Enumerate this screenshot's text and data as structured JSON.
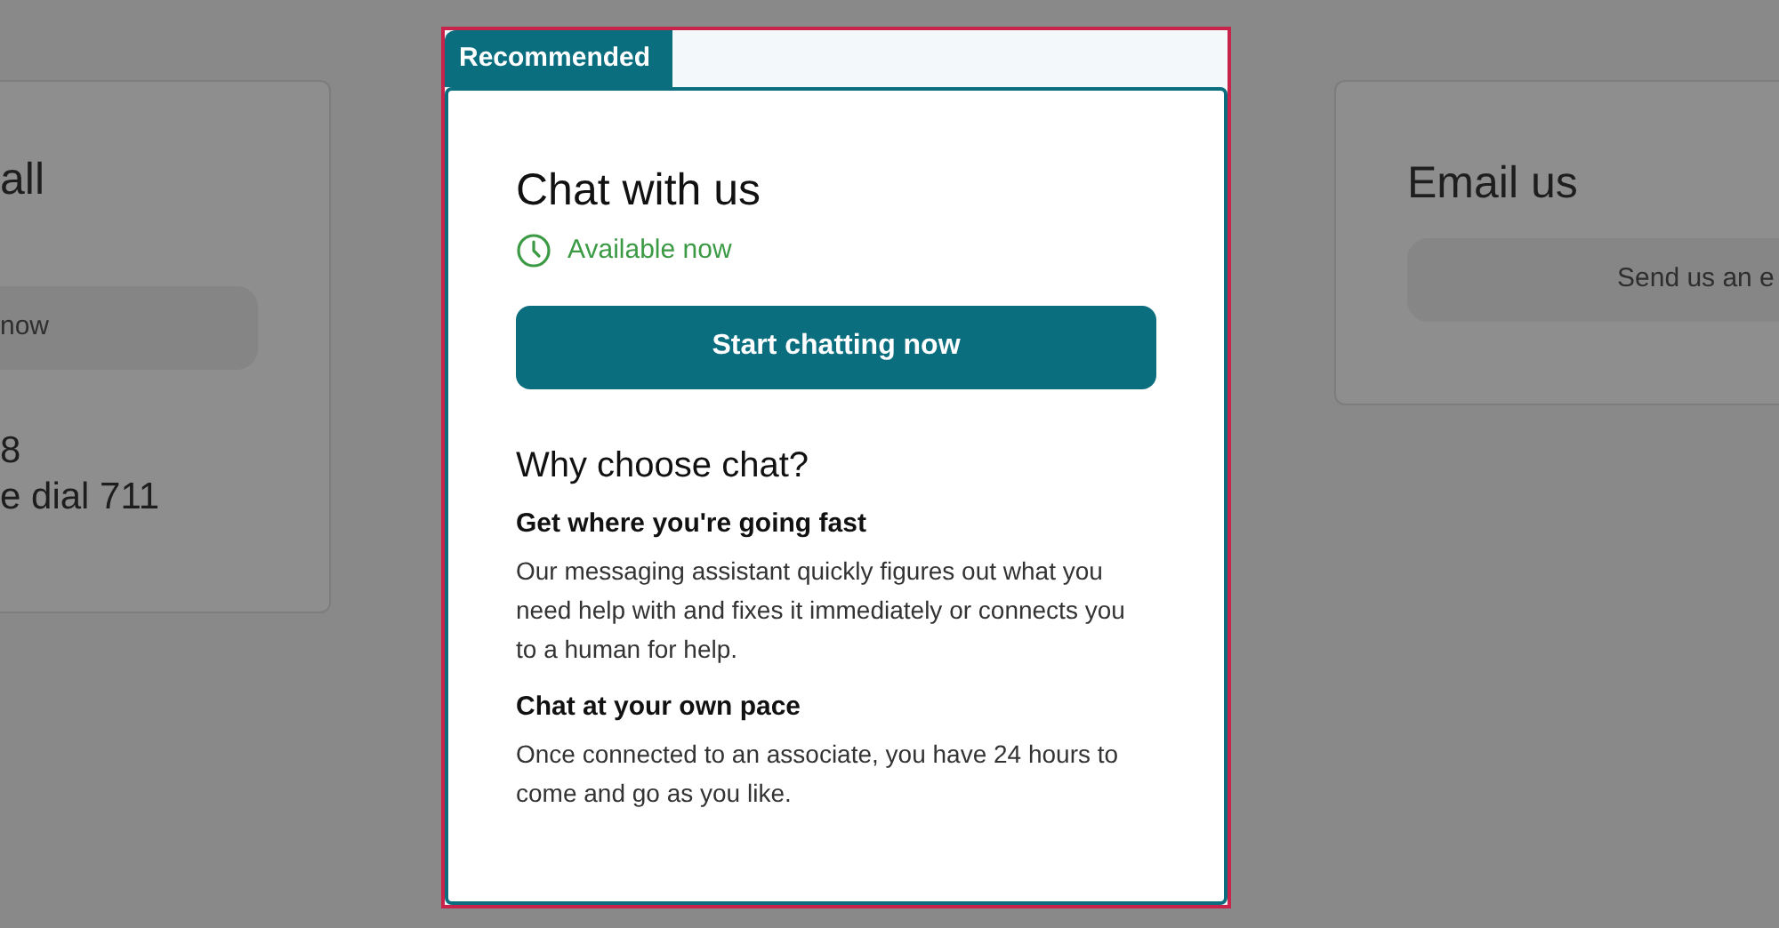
{
  "call_card": {
    "title": "all",
    "button": "now",
    "lines": [
      "8",
      "e dial 711"
    ]
  },
  "chat_card": {
    "badge": "Recommended",
    "title": "Chat with us",
    "availability": "Available now",
    "button": "Start chatting now",
    "section_title": "Why choose chat?",
    "reasons": [
      {
        "title": "Get where you're going fast",
        "text": "Our messaging assistant quickly figures out what you need help with and fixes it immediately or connects you to a human for help."
      },
      {
        "title": "Chat at your own pace",
        "text": "Once connected to an associate, you have 24 hours to come and go as you like."
      }
    ]
  },
  "email_card": {
    "title": "Email us",
    "button": "Send us an e"
  }
}
